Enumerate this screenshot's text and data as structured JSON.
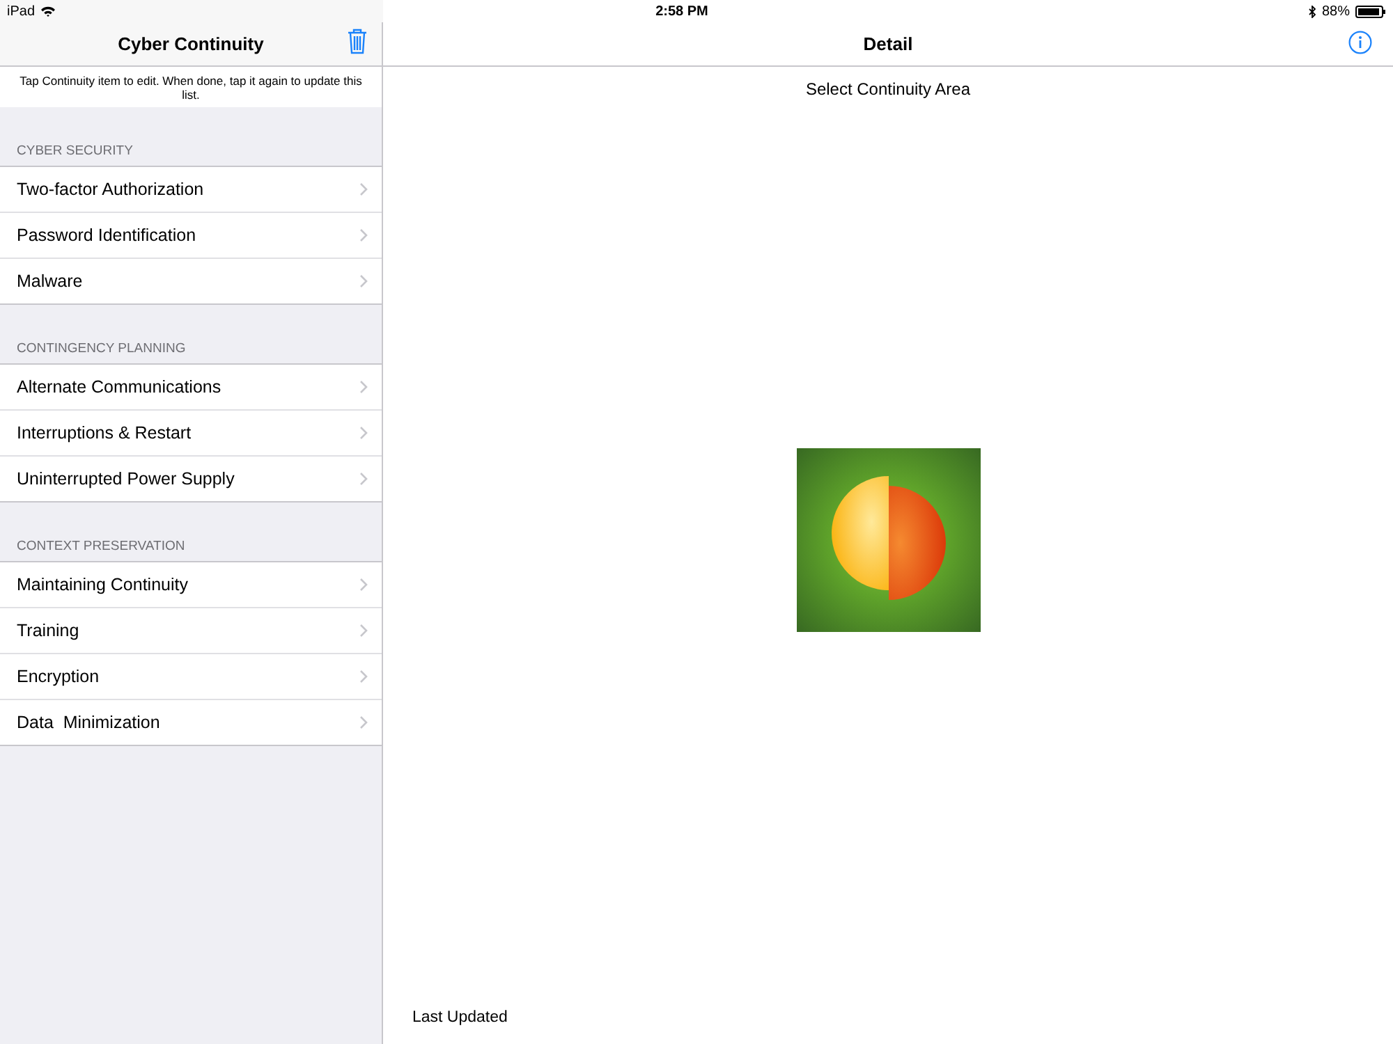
{
  "status_bar": {
    "device": "iPad",
    "time": "2:58 PM",
    "battery": "88%"
  },
  "master": {
    "title": "Cyber Continuity",
    "hint": "Tap Continuity item to edit. When done, tap it again to update this list.",
    "sections": [
      {
        "header": "CYBER SECURITY",
        "items": [
          "Two-factor Authorization",
          "Password Identification",
          "Malware"
        ]
      },
      {
        "header": "CONTINGENCY PLANNING",
        "items": [
          "Alternate Communications",
          "Interruptions & Restart",
          "Uninterrupted Power Supply"
        ]
      },
      {
        "header": "CONTEXT PRESERVATION",
        "items": [
          "Maintaining Continuity",
          "Training",
          "Encryption",
          "Data  Minimization"
        ]
      }
    ]
  },
  "detail": {
    "title": "Detail",
    "prompt": "Select Continuity Area",
    "footer": "Last Updated"
  }
}
